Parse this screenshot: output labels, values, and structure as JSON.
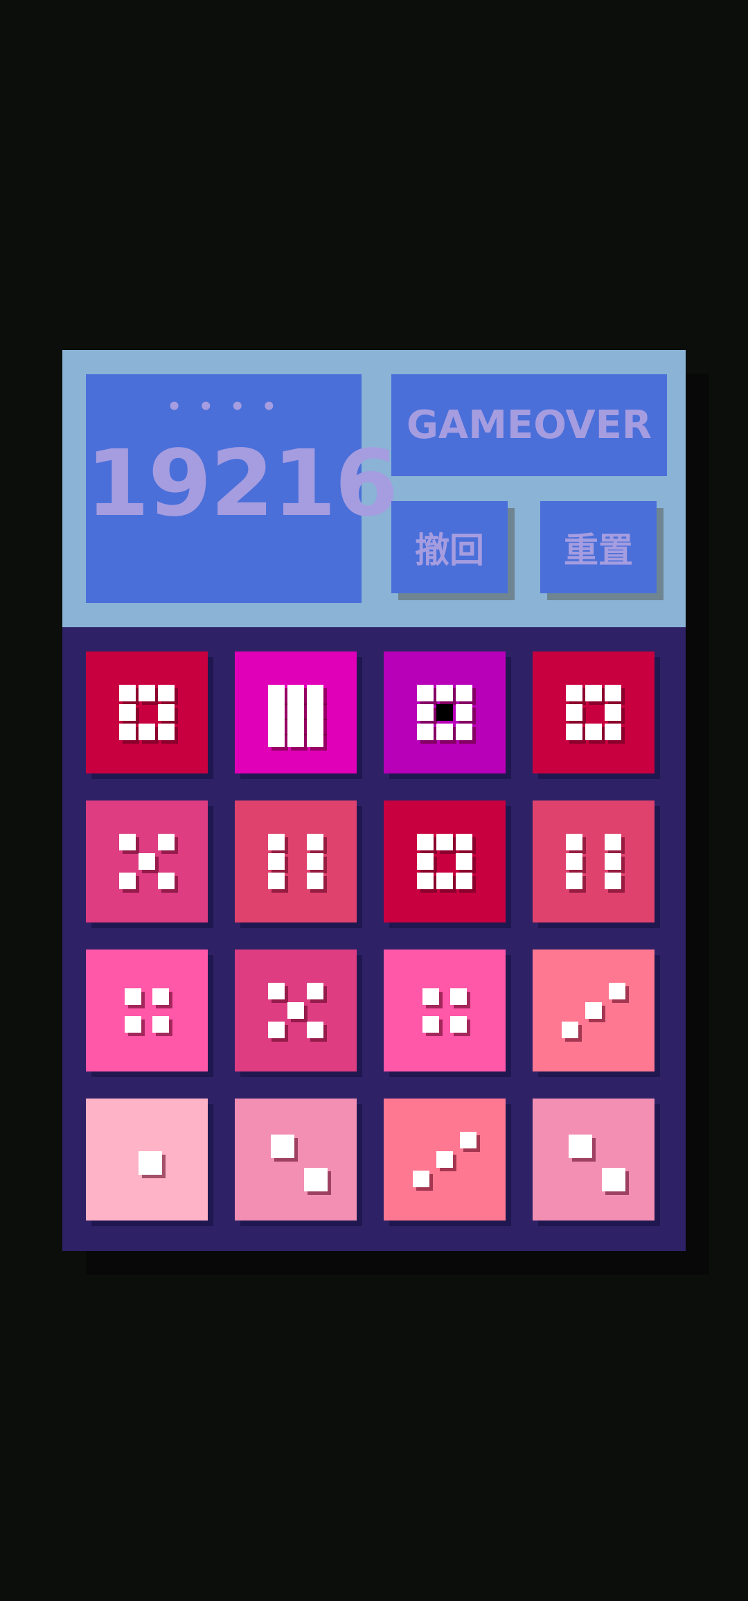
{
  "header": {
    "dots": "• • • •",
    "score": "19216",
    "status": "GAMEOVER",
    "undo_label": "撤回",
    "reset_label": "重置"
  },
  "colors": {
    "background": "#0c0e0c",
    "header_bg": "#8ab3d6",
    "panel_blue": "#4a6fd9",
    "panel_text": "#a59de0",
    "board_bg": "#2e2166"
  },
  "board": {
    "rows": 4,
    "cols": 4,
    "tiles": [
      {
        "pattern": "ring8",
        "color": "#c8003f"
      },
      {
        "pattern": "grid12",
        "color": "#e000b8"
      },
      {
        "pattern": "ring8center",
        "color": "#b800b8"
      },
      {
        "pattern": "ring8",
        "color": "#c8003f"
      },
      {
        "pattern": "five",
        "color": "#de3d82"
      },
      {
        "pattern": "six",
        "color": "#e0426e"
      },
      {
        "pattern": "ring8",
        "color": "#c8003f"
      },
      {
        "pattern": "six",
        "color": "#e0426e"
      },
      {
        "pattern": "four",
        "color": "#ff58a8"
      },
      {
        "pattern": "five",
        "color": "#de3d82"
      },
      {
        "pattern": "four",
        "color": "#ff58a8"
      },
      {
        "pattern": "three",
        "color": "#ff7891"
      },
      {
        "pattern": "one",
        "color": "#ffb3c6"
      },
      {
        "pattern": "two",
        "color": "#f28fb3"
      },
      {
        "pattern": "three",
        "color": "#ff7891"
      },
      {
        "pattern": "two",
        "color": "#f28fb3"
      }
    ]
  }
}
